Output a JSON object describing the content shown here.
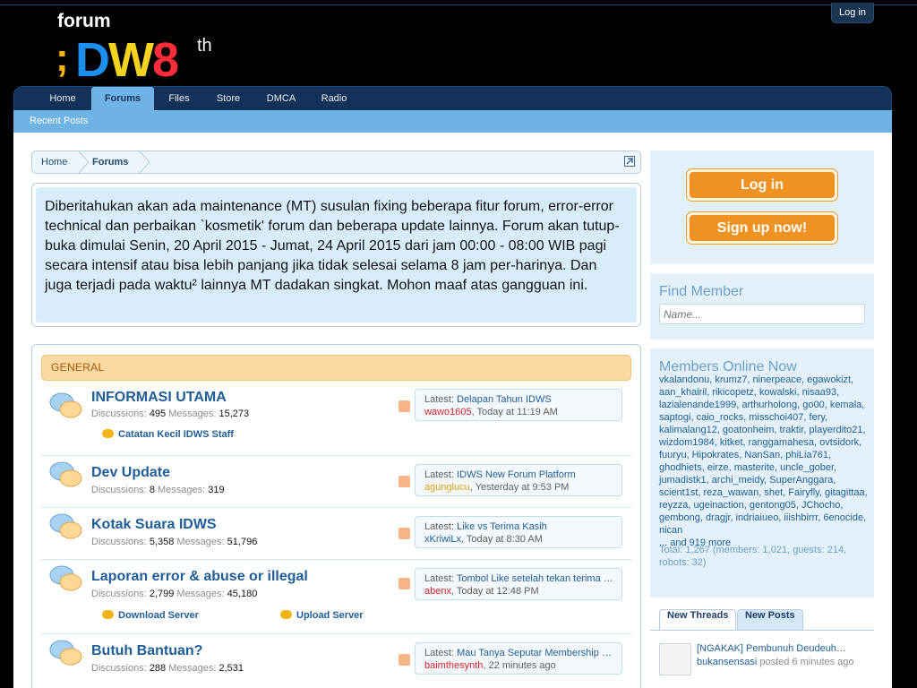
{
  "header": {
    "logo_forum": "forum",
    "logo_letters": [
      "D",
      "W",
      "8"
    ],
    "logo_suffix": "th",
    "login_label": "Log in"
  },
  "nav": {
    "tabs": [
      "Home",
      "Forums",
      "Files",
      "Store",
      "DMCA",
      "Radio"
    ],
    "active_tab": "Forums",
    "sub": "Recent Posts"
  },
  "breadcrumb": [
    "Home",
    "Forums"
  ],
  "notice": "Diberitahukan akan ada maintenance (MT) susulan fixing beberapa fitur forum, error-error technical dan perbaikan `kosmetik' forum dan beberapa update lainnya. Forum akan tutup-buka dimulai Senin, 20 April 2015 - Jumat, 24 April 2015 dari jam 00:00 - 08:00 WIB pagi secara intensif atau bisa lebih panjang jika tidak selesai selama 8 jam per-harinya. Dan juga terjadi pada waktu² lainnya MT dadakan singkat. Mohon maaf atas gangguan ini.",
  "category": "GENERAL",
  "forums": [
    {
      "title": "INFORMASI UTAMA",
      "discussions_label": "Discussions:",
      "discussions": "495",
      "messages_label": "Messages:",
      "messages": "15,273",
      "latest_label": "Latest:",
      "latest_title": "Delapan Tahun IDWS",
      "latest_user": "wawo1605",
      "latest_time": "Today at 11:19 AM",
      "subforums": [
        "Catatan Kecil IDWS Staff"
      ]
    },
    {
      "title": "Dev Update",
      "discussions_label": "Discussions:",
      "discussions": "8",
      "messages_label": "Messages:",
      "messages": "319",
      "latest_label": "Latest:",
      "latest_title": "IDWS New Forum Platform",
      "latest_user": "agunglucu",
      "latest_time": "Yesterday at 9:53 PM",
      "subforums": []
    },
    {
      "title": "Kotak Suara IDWS",
      "discussions_label": "Discussions:",
      "discussions": "5,358",
      "messages_label": "Messages:",
      "messages": "51,796",
      "latest_label": "Latest:",
      "latest_title": "Like vs Terima Kasih",
      "latest_user": "xKriwiLx",
      "latest_time": "Today at 8:30 AM",
      "subforums": []
    },
    {
      "title": "Laporan error & abuse or illegal",
      "discussions_label": "Discussions:",
      "discussions": "2,799",
      "messages_label": "Messages:",
      "messages": "45,180",
      "latest_label": "Latest:",
      "latest_title": "Tombol Like setelah tekan terima …",
      "latest_user": "abenx",
      "latest_time": "Today at 12:48 PM",
      "subforums": [
        "Download Server",
        "Upload Server"
      ]
    },
    {
      "title": "Butuh Bantuan?",
      "discussions_label": "Discussions:",
      "discussions": "288",
      "messages_label": "Messages:",
      "messages": "2,531",
      "latest_label": "Latest:",
      "latest_title": "Mau Tanya Seputar Membership …",
      "latest_user": "baimthesynth",
      "latest_time": "22 minutes ago",
      "subforums": []
    }
  ],
  "sidebar": {
    "login_btn": "Log in",
    "signup_btn": "Sign up now!",
    "find_title": "Find Member",
    "find_placeholder": "Name...",
    "online_title": "Members Online Now",
    "online_members": "vkalandonu, krumz7, ninerpeace, egawokizt, aan_khairil, rikicopetz, kowalski, nisaa93, lazialenande1999, arthurholong, go00, kemala, saptogi, caio_rocks, misschoi407, fery, kalimalang12, goatonheim, traktir, playerdito21, wizdom1984, kitket, ranggamahesa, ovtsidork, fuuryu, Hipokrates, NanSan, phiLia761, ghodhiets, eirze, masterite, uncle_gober, jumadistk1, archi_meidy, SuperAnggara, scient1st, reza_wawan, shet, Fairyfly, gitagittaa, reyzza, ugeinaction, gentong05, JChocho, gembong, dragjr, indriaiueo, iiishbirrr, 6enocide, nican",
    "online_more": "... and 919 more",
    "online_total": "Total: 1,267 (members: 1,021, guests: 214, robots: 32)",
    "tabs": [
      "New Threads",
      "New Posts"
    ],
    "threads": [
      {
        "title": "[NGAKAK] Pembunuh Deudeuh…",
        "user": "bukansensasi",
        "meta": "posted 6 minutes ago"
      }
    ]
  },
  "colors": {
    "nav_bg": "#143259",
    "accent": "#6eb3e4",
    "category_bg": "#fbd9a3",
    "button_orange": "#ef9221",
    "link": "#1f5d96"
  }
}
